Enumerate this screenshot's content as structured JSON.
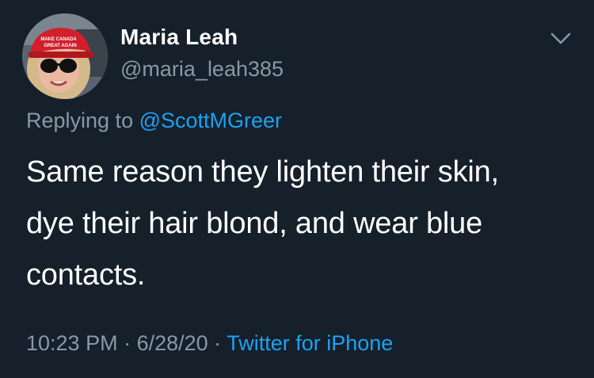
{
  "author": {
    "name": "Maria Leah",
    "handle": "@maria_leah385"
  },
  "avatar": {
    "hat_text_line1": "MAKE CANADA",
    "hat_text_line2": "GREAT AGAIN"
  },
  "reply": {
    "prefix": "Replying to",
    "mention": "@ScottMGreer"
  },
  "tweet": {
    "line1": "Same reason they lighten their skin,",
    "line2": "dye their hair blond, and wear blue",
    "line3": "contacts."
  },
  "meta": {
    "time": "10:23 PM",
    "separator1": " · ",
    "date": "6/28/20",
    "separator2": " · ",
    "source": "Twitter for iPhone"
  },
  "colors": {
    "background": "#15202b",
    "primary_text": "#ffffff",
    "secondary_text": "#8899a6",
    "link": "#1da1f2"
  },
  "icons": {
    "menu": "chevron-down-icon"
  }
}
